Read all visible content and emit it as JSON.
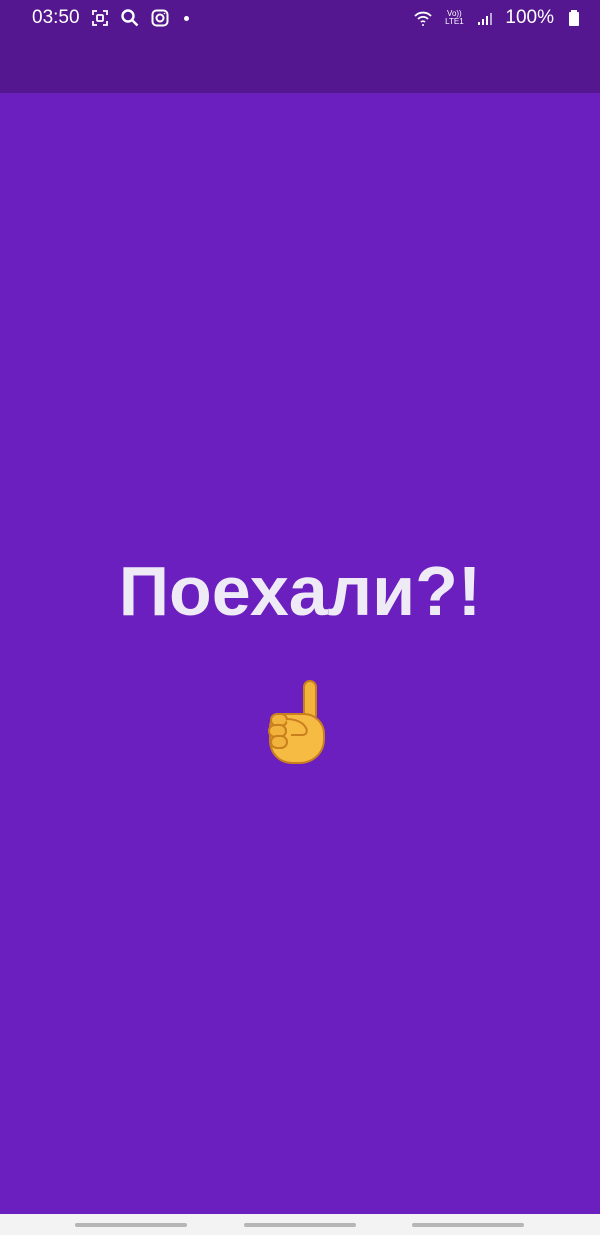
{
  "status_bar": {
    "time": "03:50",
    "icons_left": [
      "screen-capture-icon",
      "search-icon",
      "instagram-icon",
      "notification-dot-icon"
    ],
    "network_top": "Vo))",
    "network_bottom": "LTE1",
    "battery": "100%",
    "icons_right": [
      "wifi-icon",
      "signal-icon",
      "battery-icon"
    ]
  },
  "main": {
    "title": "Поехали?!",
    "emoji_icon": "index-pointing-up-icon"
  },
  "colors": {
    "status_bar": "#55178f",
    "background": "#6c1fbf",
    "text": "#eeeaf6",
    "nav_bar": "#f3f3f3"
  }
}
